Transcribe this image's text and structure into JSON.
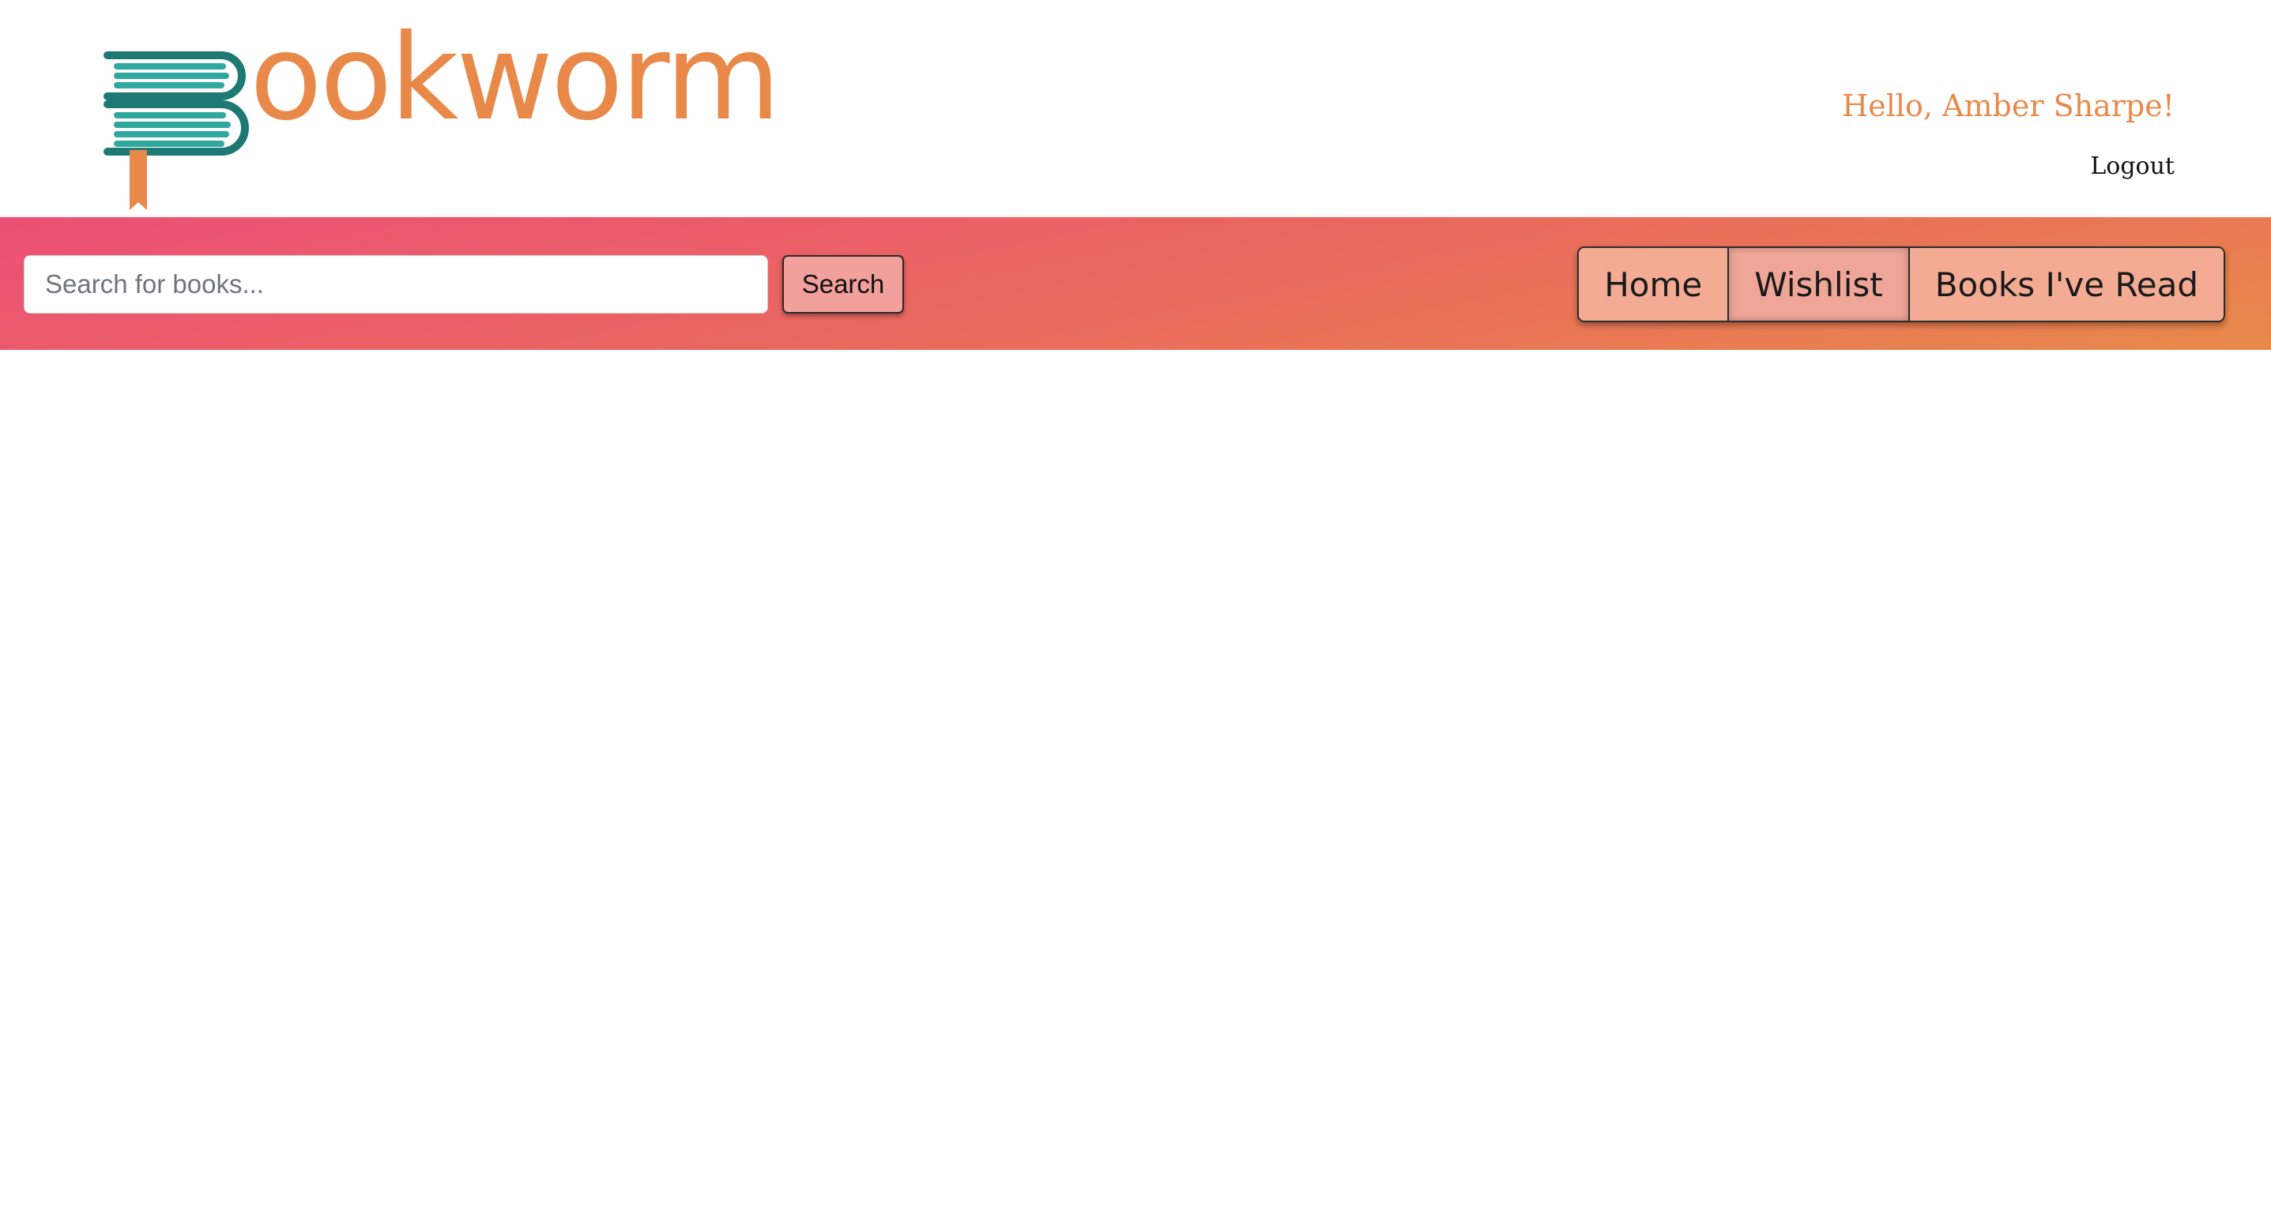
{
  "brand": {
    "name": "ookworm",
    "accent_color": "#e8894a",
    "icon": "book-stack-b-logo-icon"
  },
  "user": {
    "greeting": "Hello, Amber Sharpe!",
    "logout_label": "Logout"
  },
  "search": {
    "placeholder": "Search for books...",
    "value": "",
    "button_label": "Search"
  },
  "nav": {
    "items": [
      {
        "label": "Home"
      },
      {
        "label": "Wishlist"
      },
      {
        "label": "Books I've Read"
      }
    ]
  },
  "colors": {
    "navbar_gradient_start": "#ec5076",
    "navbar_gradient_end": "#e8894a",
    "button_fill": "#f3ab94",
    "logo_teal_dark": "#1e7873",
    "logo_teal_light": "#2fa89f"
  }
}
